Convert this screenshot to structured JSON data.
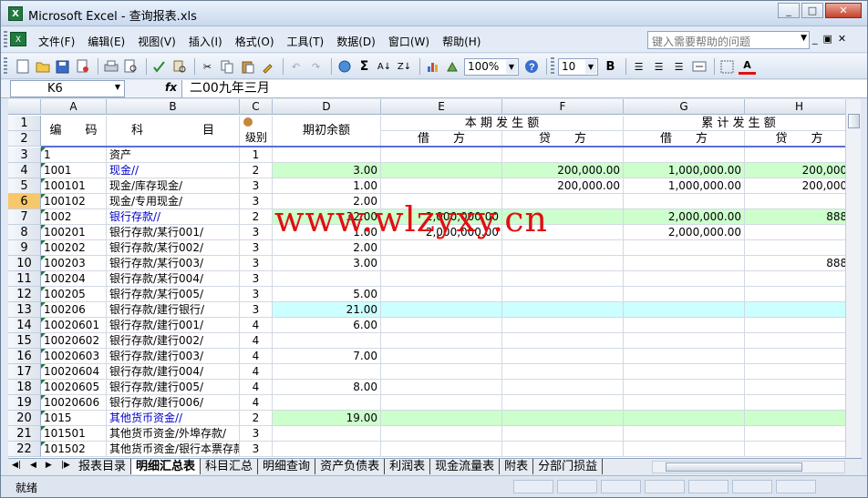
{
  "window": {
    "title": "Microsoft Excel - 查询报表.xls",
    "app_icon": "X"
  },
  "menu": [
    "文件(F)",
    "编辑(E)",
    "视图(V)",
    "插入(I)",
    "格式(O)",
    "工具(T)",
    "数据(D)",
    "窗口(W)",
    "帮助(H)"
  ],
  "help_placeholder": "键入需要帮助的问题",
  "toolbar": {
    "zoom": "100%",
    "font_size": "10",
    "bold": "B",
    "sigma": "Σ"
  },
  "formula_bar": {
    "name_box": "K6",
    "fx": "fx",
    "content": "二00九年三月"
  },
  "columns": [
    "A",
    "B",
    "C",
    "D",
    "E",
    "F",
    "G",
    "H"
  ],
  "header": {
    "code": "编　　码",
    "subject": "科　　　　　目",
    "level": "级别",
    "opening": "期初余额",
    "current": "本 期 发 生 额",
    "cumulative": "累 计 发 生 额",
    "debit": "借　　方",
    "credit": "贷　　方"
  },
  "rows": [
    {
      "n": "3",
      "code": "1",
      "name": "资产",
      "lvl": "1",
      "d": "",
      "e": "",
      "f": "",
      "g": "",
      "h": "",
      "hl": "",
      "blue": false
    },
    {
      "n": "4",
      "code": "1001",
      "name": "现金//",
      "lvl": "2",
      "d": "3.00",
      "e": "",
      "f": "200,000.00",
      "g": "1,000,000.00",
      "h": "200,000.",
      "hl": "green",
      "blue": true
    },
    {
      "n": "5",
      "code": "100101",
      "name": "现金/库存现金/",
      "lvl": "3",
      "d": "1.00",
      "e": "",
      "f": "200,000.00",
      "g": "1,000,000.00",
      "h": "200,000.",
      "hl": "",
      "blue": false
    },
    {
      "n": "6",
      "code": "100102",
      "name": "现金/专用现金/",
      "lvl": "3",
      "d": "2.00",
      "e": "",
      "f": "",
      "g": "",
      "h": "",
      "hl": "",
      "blue": false,
      "sel": true
    },
    {
      "n": "7",
      "code": "1002",
      "name": "银行存款//",
      "lvl": "2",
      "d": "32.00",
      "e": "2,000,000.00",
      "f": "",
      "g": "2,000,000.00",
      "h": "888.",
      "hl": "green",
      "blue": true
    },
    {
      "n": "8",
      "code": "100201",
      "name": "银行存款/某行001/",
      "lvl": "3",
      "d": "1.00",
      "e": "2,000,000.00",
      "f": "",
      "g": "2,000,000.00",
      "h": "",
      "hl": "",
      "blue": false
    },
    {
      "n": "9",
      "code": "100202",
      "name": "银行存款/某行002/",
      "lvl": "3",
      "d": "2.00",
      "e": "",
      "f": "",
      "g": "",
      "h": "",
      "hl": "",
      "blue": false
    },
    {
      "n": "10",
      "code": "100203",
      "name": "银行存款/某行003/",
      "lvl": "3",
      "d": "3.00",
      "e": "",
      "f": "",
      "g": "",
      "h": "888.",
      "hl": "",
      "blue": false
    },
    {
      "n": "11",
      "code": "100204",
      "name": "银行存款/某行004/",
      "lvl": "3",
      "d": "",
      "e": "",
      "f": "",
      "g": "",
      "h": "",
      "hl": "",
      "blue": false
    },
    {
      "n": "12",
      "code": "100205",
      "name": "银行存款/某行005/",
      "lvl": "3",
      "d": "5.00",
      "e": "",
      "f": "",
      "g": "",
      "h": "",
      "hl": "",
      "blue": false
    },
    {
      "n": "13",
      "code": "100206",
      "name": "银行存款/建行银行/",
      "lvl": "3",
      "d": "21.00",
      "e": "",
      "f": "",
      "g": "",
      "h": "",
      "hl": "cyan",
      "blue": false
    },
    {
      "n": "14",
      "code": "10020601",
      "name": "银行存款/建行001/",
      "lvl": "4",
      "d": "6.00",
      "e": "",
      "f": "",
      "g": "",
      "h": "",
      "hl": "",
      "blue": false
    },
    {
      "n": "15",
      "code": "10020602",
      "name": "银行存款/建行002/",
      "lvl": "4",
      "d": "",
      "e": "",
      "f": "",
      "g": "",
      "h": "",
      "hl": "",
      "blue": false
    },
    {
      "n": "16",
      "code": "10020603",
      "name": "银行存款/建行003/",
      "lvl": "4",
      "d": "7.00",
      "e": "",
      "f": "",
      "g": "",
      "h": "",
      "hl": "",
      "blue": false
    },
    {
      "n": "17",
      "code": "10020604",
      "name": "银行存款/建行004/",
      "lvl": "4",
      "d": "",
      "e": "",
      "f": "",
      "g": "",
      "h": "",
      "hl": "",
      "blue": false
    },
    {
      "n": "18",
      "code": "10020605",
      "name": "银行存款/建行005/",
      "lvl": "4",
      "d": "8.00",
      "e": "",
      "f": "",
      "g": "",
      "h": "",
      "hl": "",
      "blue": false
    },
    {
      "n": "19",
      "code": "10020606",
      "name": "银行存款/建行006/",
      "lvl": "4",
      "d": "",
      "e": "",
      "f": "",
      "g": "",
      "h": "",
      "hl": "",
      "blue": false
    },
    {
      "n": "20",
      "code": "1015",
      "name": "其他货币资金//",
      "lvl": "2",
      "d": "19.00",
      "e": "",
      "f": "",
      "g": "",
      "h": "",
      "hl": "green",
      "blue": true
    },
    {
      "n": "21",
      "code": "101501",
      "name": "其他货币资金/外埠存款/",
      "lvl": "3",
      "d": "",
      "e": "",
      "f": "",
      "g": "",
      "h": "",
      "hl": "",
      "blue": false
    },
    {
      "n": "22",
      "code": "101502",
      "name": "其他货币资金/银行本票存款/",
      "lvl": "3",
      "d": "",
      "e": "",
      "f": "",
      "g": "",
      "h": "",
      "hl": "",
      "blue": false
    }
  ],
  "watermark": "www.wlzyxy.cn",
  "sheets": [
    "报表目录",
    "明细汇总表",
    "科目汇总",
    "明细查询",
    "资产负债表",
    "利润表",
    "现金流量表",
    "附表",
    "分部门损益"
  ],
  "active_sheet": "明细汇总表",
  "status": "就绪",
  "colors": {
    "green": "#ccffcc",
    "cyan": "#ccffff",
    "blue_text": "#0000cc"
  }
}
